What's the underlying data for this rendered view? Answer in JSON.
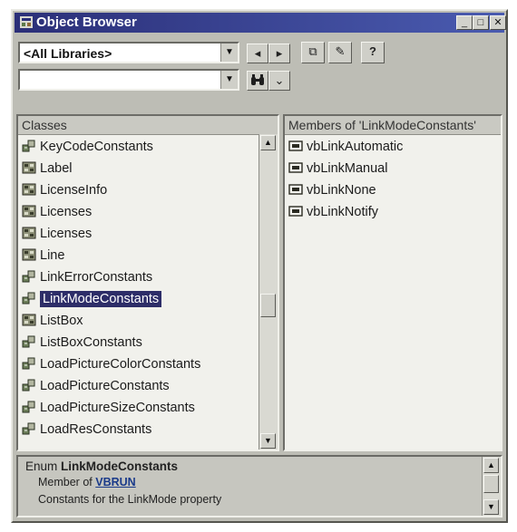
{
  "window": {
    "title": "Object Browser",
    "controls": {
      "minimize": "_",
      "maximize": "□",
      "close": "✕"
    }
  },
  "toolbar": {
    "library_select": {
      "value": "<All Libraries>"
    },
    "search_input": {
      "value": ""
    },
    "buttons": [
      {
        "name": "back",
        "icon": "◂"
      },
      {
        "name": "forward",
        "icon": "▸"
      },
      {
        "name": "copy",
        "icon": "⧉"
      },
      {
        "name": "view-definition",
        "icon": "✎"
      },
      {
        "name": "help",
        "icon": "?"
      },
      {
        "name": "search",
        "icon": "binoculars"
      },
      {
        "name": "toggle-results",
        "icon": "⌄"
      }
    ]
  },
  "classes": {
    "header": "Classes",
    "items": [
      {
        "label": "KeyCodeConstants",
        "icon": "enum"
      },
      {
        "label": "Label",
        "icon": "class"
      },
      {
        "label": "LicenseInfo",
        "icon": "class"
      },
      {
        "label": "Licenses",
        "icon": "class"
      },
      {
        "label": "Licenses",
        "icon": "class"
      },
      {
        "label": "Line",
        "icon": "class"
      },
      {
        "label": "LinkErrorConstants",
        "icon": "enum"
      },
      {
        "label": "LinkModeConstants",
        "icon": "enum",
        "selected": true
      },
      {
        "label": "ListBox",
        "icon": "class"
      },
      {
        "label": "ListBoxConstants",
        "icon": "enum"
      },
      {
        "label": "LoadPictureColorConstants",
        "icon": "enum"
      },
      {
        "label": "LoadPictureConstants",
        "icon": "enum"
      },
      {
        "label": "LoadPictureSizeConstants",
        "icon": "enum"
      },
      {
        "label": "LoadResConstants",
        "icon": "enum"
      }
    ]
  },
  "members": {
    "header": "Members of 'LinkModeConstants'",
    "items": [
      {
        "label": "vbLinkAutomatic",
        "icon": "constant"
      },
      {
        "label": "vbLinkManual",
        "icon": "constant"
      },
      {
        "label": "vbLinkNone",
        "icon": "constant"
      },
      {
        "label": "vbLinkNotify",
        "icon": "constant"
      }
    ]
  },
  "details": {
    "kind": "Enum",
    "name": "LinkModeConstants",
    "member_of_prefix": "Member of",
    "member_of_link": "VBRUN",
    "description": "Constants for the LinkMode property"
  },
  "colors": {
    "title_bar": "#2b2f78",
    "selection": "#2d2d68",
    "face": "#bdbdb5"
  }
}
